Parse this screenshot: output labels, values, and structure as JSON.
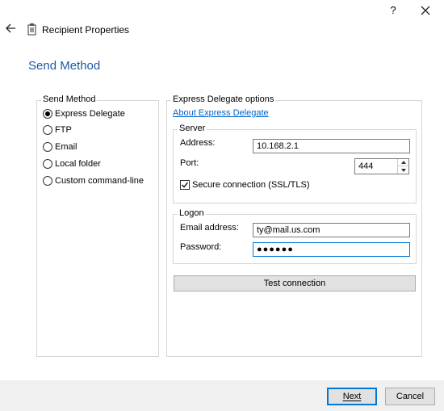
{
  "titlebar": {
    "help_label": "?",
    "window_title": "Recipient Properties"
  },
  "page": {
    "title": "Send Method"
  },
  "send_method": {
    "group_label": "Send Method",
    "options": [
      {
        "label": "Express Delegate",
        "checked": true
      },
      {
        "label": "FTP",
        "checked": false
      },
      {
        "label": "Email",
        "checked": false
      },
      {
        "label": "Local folder",
        "checked": false
      },
      {
        "label": "Custom command-line",
        "checked": false
      }
    ]
  },
  "express": {
    "group_label": "Express Delegate options",
    "about_link": "About Express Delegate",
    "server": {
      "group_label": "Server",
      "address_label": "Address:",
      "address_value": "10.168.2.1",
      "port_label": "Port:",
      "port_value": "444",
      "secure_label": "Secure connection (SSL/TLS)",
      "secure_checked": true
    },
    "logon": {
      "group_label": "Logon",
      "email_label": "Email address:",
      "email_value": "ty@mail.us.com",
      "password_label": "Password:",
      "password_value": "●●●●●●"
    },
    "test_button": "Test connection"
  },
  "footer": {
    "next_button": "Next",
    "cancel_button": "Cancel"
  },
  "colors": {
    "accent": "#0078d7",
    "title": "#1f5aa6",
    "link": "#0066cc"
  }
}
